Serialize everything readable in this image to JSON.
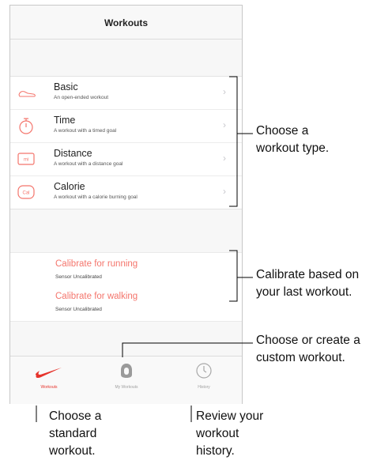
{
  "screen": {
    "title": "Workouts",
    "workouts": [
      {
        "title": "Basic",
        "subtitle": "An open-ended workout",
        "icon": "shoe-icon"
      },
      {
        "title": "Time",
        "subtitle": "A workout with a timed goal",
        "icon": "stopwatch-icon"
      },
      {
        "title": "Distance",
        "subtitle": "A workout with a distance goal",
        "icon": "distance-icon"
      },
      {
        "title": "Calorie",
        "subtitle": "A workout with a calorie burning goal",
        "icon": "calorie-icon"
      }
    ],
    "calibration": [
      {
        "title": "Calibrate for running",
        "status": "Sensor Uncalibrated"
      },
      {
        "title": "Calibrate for walking",
        "status": "Sensor Uncalibrated"
      }
    ],
    "tabs": [
      {
        "label": "Workouts",
        "icon": "nike-swoosh-icon",
        "active": true
      },
      {
        "label": "My Workouts",
        "icon": "my-workouts-icon",
        "active": false
      },
      {
        "label": "History",
        "icon": "history-clock-icon",
        "active": false
      }
    ],
    "accent_color": "#f4756c",
    "active_tab_color": "#e6342c"
  },
  "callouts": {
    "workout_type": [
      "Choose a",
      "workout type."
    ],
    "calibrate": [
      "Calibrate based on",
      "your last workout."
    ],
    "custom": [
      "Choose or create a",
      "custom workout."
    ],
    "standard": [
      "Choose a",
      "standard",
      "workout."
    ],
    "history": [
      "Review your",
      "workout",
      "history."
    ]
  }
}
